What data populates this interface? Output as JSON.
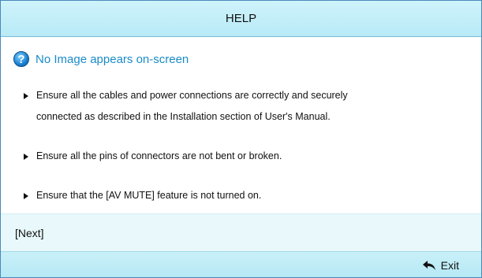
{
  "header": {
    "title": "HELP"
  },
  "question": {
    "icon": "question-icon",
    "text": "No Image appears on-screen"
  },
  "bullets": [
    {
      "lines": [
        "Ensure all the cables and power connections are correctly and securely",
        "connected as described in the Installation section of User's Manual."
      ]
    },
    {
      "lines": [
        "Ensure all the pins of connectors are not bent or broken."
      ]
    },
    {
      "lines": [
        "Ensure that the [AV MUTE] feature is not turned on."
      ]
    }
  ],
  "next": {
    "label": "[Next]"
  },
  "footer": {
    "exit_label": "Exit",
    "exit_icon": "return-arrow-icon"
  },
  "colors": {
    "accent": "#1a8bc9",
    "bar": "#b8eaf6",
    "next_bg": "#e8f8fb",
    "border": "#4a88ba"
  }
}
